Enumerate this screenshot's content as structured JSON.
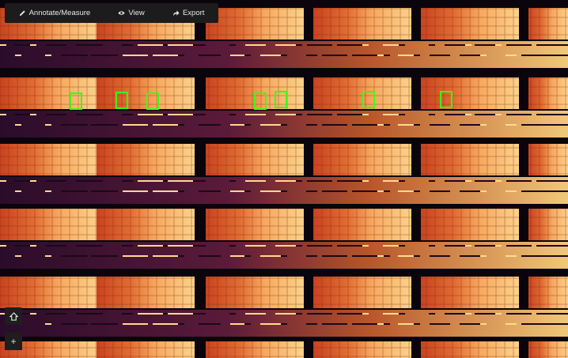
{
  "toolbar": {
    "annotate_label": "Annotate/Measure",
    "view_label": "View",
    "export_label": "Export"
  },
  "controls": {
    "zoom_in_label": "+"
  },
  "icons": {
    "annotate": "pencil-icon",
    "view": "eye-icon",
    "export": "share-arrow-icon",
    "home": "home-icon"
  },
  "colors": {
    "toolbar_bg": "#1c1c1c",
    "detection_box": "#39ff14",
    "panel_warm": "#f3a05a",
    "panel_cool": "#d8512a",
    "gap_dark": "#1a0818"
  },
  "detections_count_visible": 7
}
